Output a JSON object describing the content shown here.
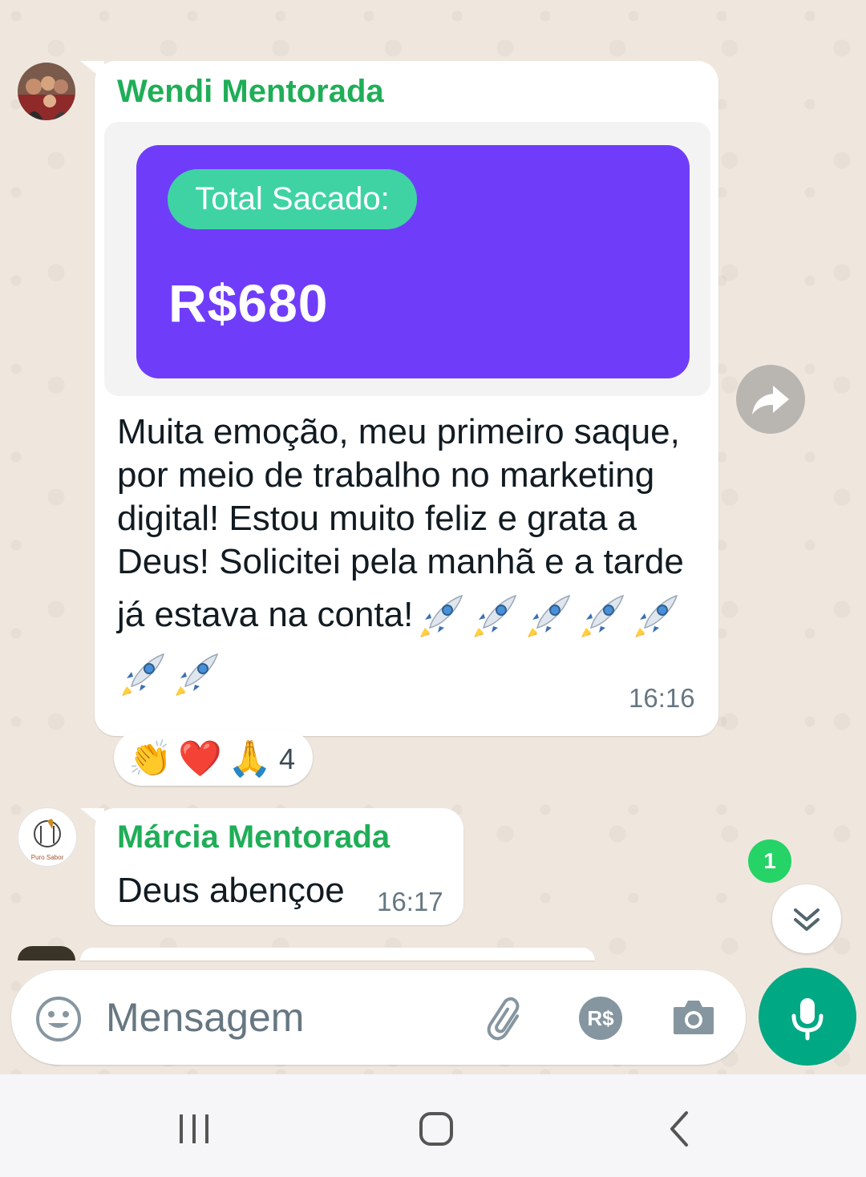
{
  "messages": [
    {
      "sender": "Wendi Mentorada",
      "image_card": {
        "pill_label": "Total Sacado:",
        "amount": "R$680"
      },
      "text_lines": [
        "Muita emoção, meu primeiro saque,",
        "por meio de trabalho no marketing",
        "digital! Estou muito feliz e grata a",
        "Deus! Solicitei pela manhã e a tarde",
        "já estava na conta!"
      ],
      "time": "16:16",
      "reactions": {
        "emojis": [
          "👏",
          "❤️",
          "🙏"
        ],
        "count": "4"
      }
    },
    {
      "sender": "Márcia Mentorada",
      "text": "Deus abençoe",
      "time": "16:17",
      "avatar_caption": "Puro Sabor"
    }
  ],
  "unread_badge": "1",
  "composer": {
    "placeholder": "Mensagem",
    "currency_label": "R$"
  },
  "icons": {
    "emoji": "emoji-icon",
    "attach": "paperclip-icon",
    "payment": "currency-icon",
    "camera": "camera-icon",
    "mic": "mic-icon",
    "forward": "forward-icon",
    "scroll": "chevron-double-down-icon",
    "rocket": "rocket-emoji"
  },
  "colors": {
    "sender_green": "#1fae57",
    "card_purple": "#6f3dfa",
    "pill_teal": "#3fd3a4",
    "accent_green": "#00a884",
    "badge_green": "#25d366"
  }
}
